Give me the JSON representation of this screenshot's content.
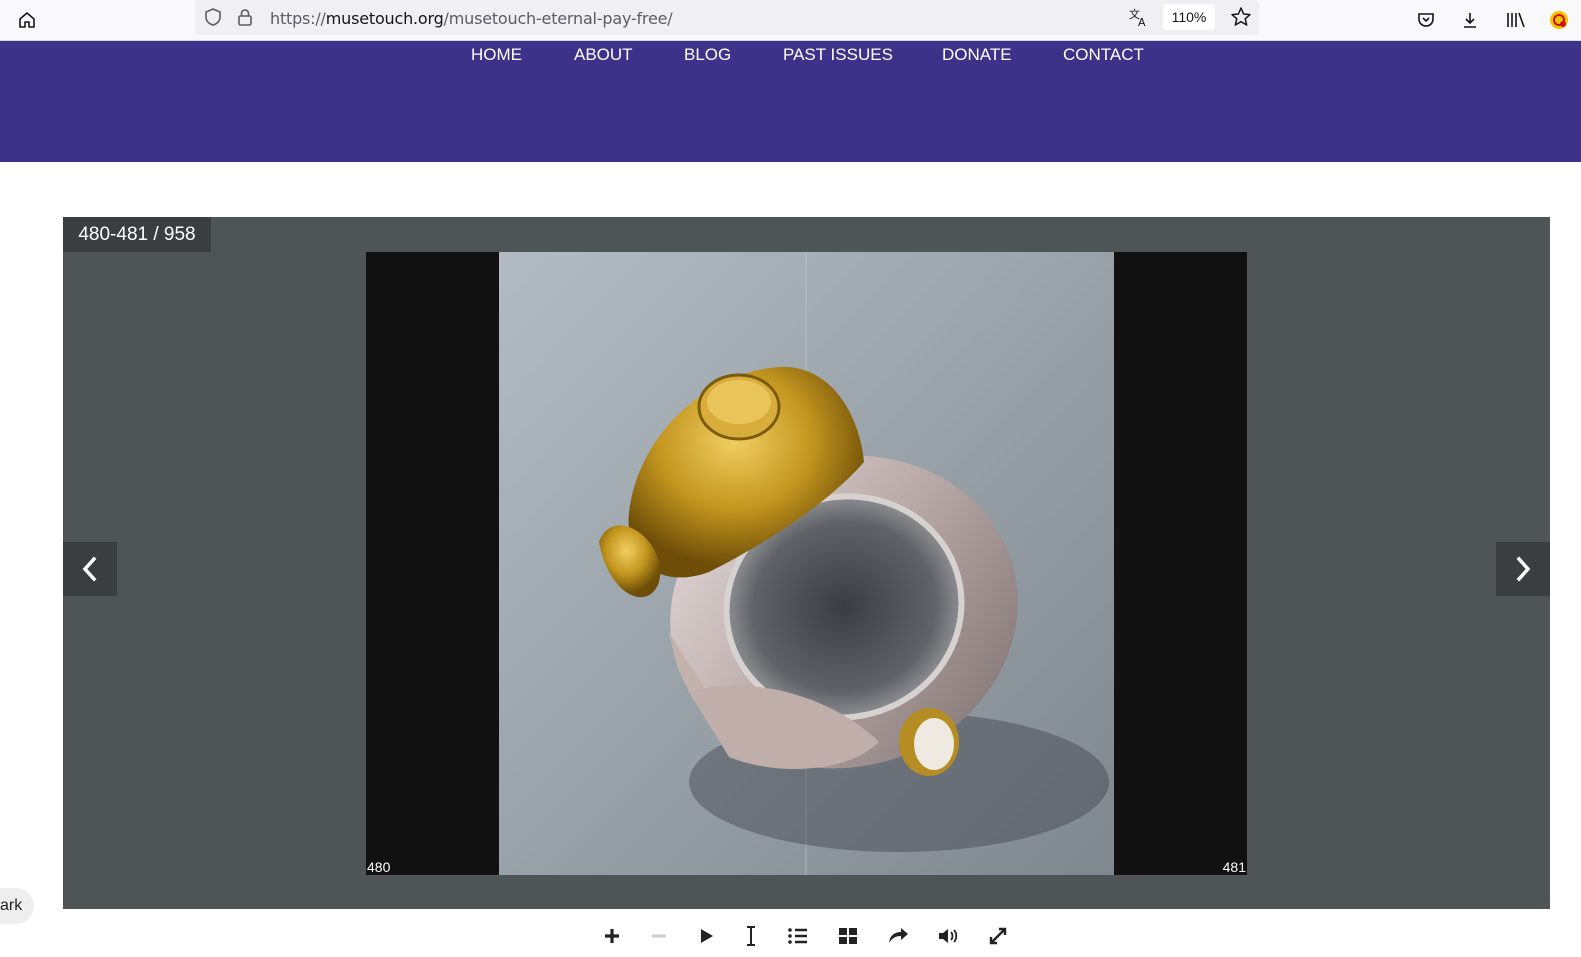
{
  "browser": {
    "url_prefix": "https://",
    "url_domain": "musetouch.org",
    "url_path": "/musetouch-eternal-pay-free/",
    "zoom": "110%",
    "icons": [
      "home-icon",
      "shield-icon",
      "lock-icon",
      "translate-icon",
      "star-icon",
      "pocket-icon",
      "download-icon",
      "library-icon",
      "extension-icon"
    ]
  },
  "site": {
    "brand_color": "#3e318a",
    "nav": [
      "HOME",
      "ABOUT",
      "BLOG",
      "PAST ISSUES",
      "DONATE",
      "CONTACT"
    ]
  },
  "viewer": {
    "counter": "480-481 / 958",
    "left_page": "480",
    "right_page": "481",
    "controls": [
      "zoom-in-icon",
      "zoom-out-icon",
      "play-icon",
      "text-cursor-icon",
      "table-of-contents-icon",
      "thumbnails-icon",
      "share-icon",
      "sound-icon",
      "fullscreen-icon"
    ]
  },
  "bookmark_chip": "ark"
}
